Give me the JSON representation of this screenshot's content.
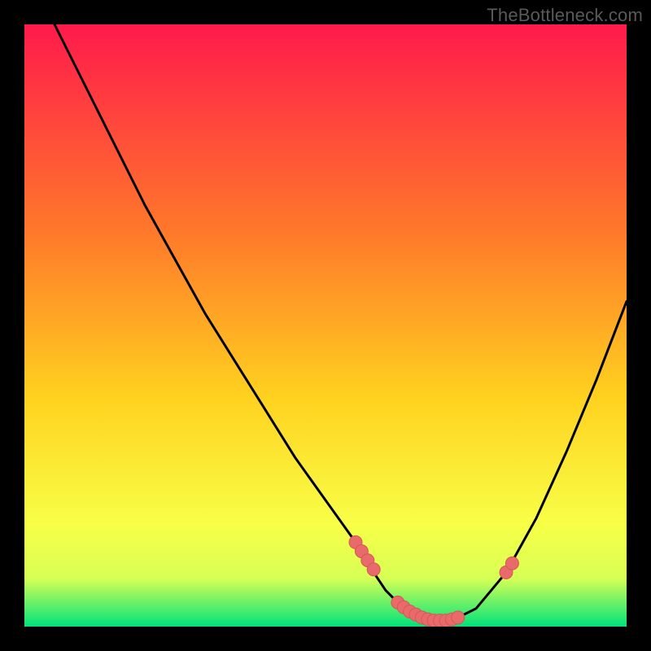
{
  "attribution": "TheBottleneck.com",
  "colors": {
    "background": "#000000",
    "gradient_top": "#ff1a4b",
    "gradient_mid1": "#ff6a2a",
    "gradient_mid2": "#ffd21f",
    "gradient_mid3": "#f8ff47",
    "gradient_bottom": "#00e37a",
    "curve": "#000000",
    "marker_fill": "#e86a6a",
    "marker_stroke": "#d85656"
  },
  "chart_data": {
    "type": "line",
    "title": "",
    "xlabel": "",
    "ylabel": "",
    "xlim": [
      0,
      100
    ],
    "ylim": [
      0,
      100
    ],
    "curve": {
      "name": "bottleneck-curve",
      "x": [
        0,
        5,
        10,
        15,
        20,
        25,
        30,
        35,
        40,
        45,
        50,
        55,
        58,
        60,
        62,
        64,
        66,
        68,
        70,
        72,
        75,
        80,
        85,
        90,
        95,
        100
      ],
      "y": [
        110,
        100,
        90,
        80,
        70,
        61,
        52,
        44,
        36,
        28,
        21,
        14,
        9,
        6,
        4,
        2.5,
        1.5,
        1,
        1,
        1.5,
        3,
        9,
        18,
        29,
        41,
        54
      ]
    },
    "markers": {
      "name": "highlight-points",
      "x": [
        55,
        56,
        57,
        58,
        62,
        63,
        64,
        65,
        66,
        67,
        68,
        69,
        70,
        71,
        72,
        80,
        81
      ],
      "y": [
        14,
        12.5,
        11,
        9.5,
        4,
        3.2,
        2.5,
        2,
        1.5,
        1.2,
        1,
        1,
        1,
        1.2,
        1.5,
        9,
        10.5
      ]
    }
  }
}
